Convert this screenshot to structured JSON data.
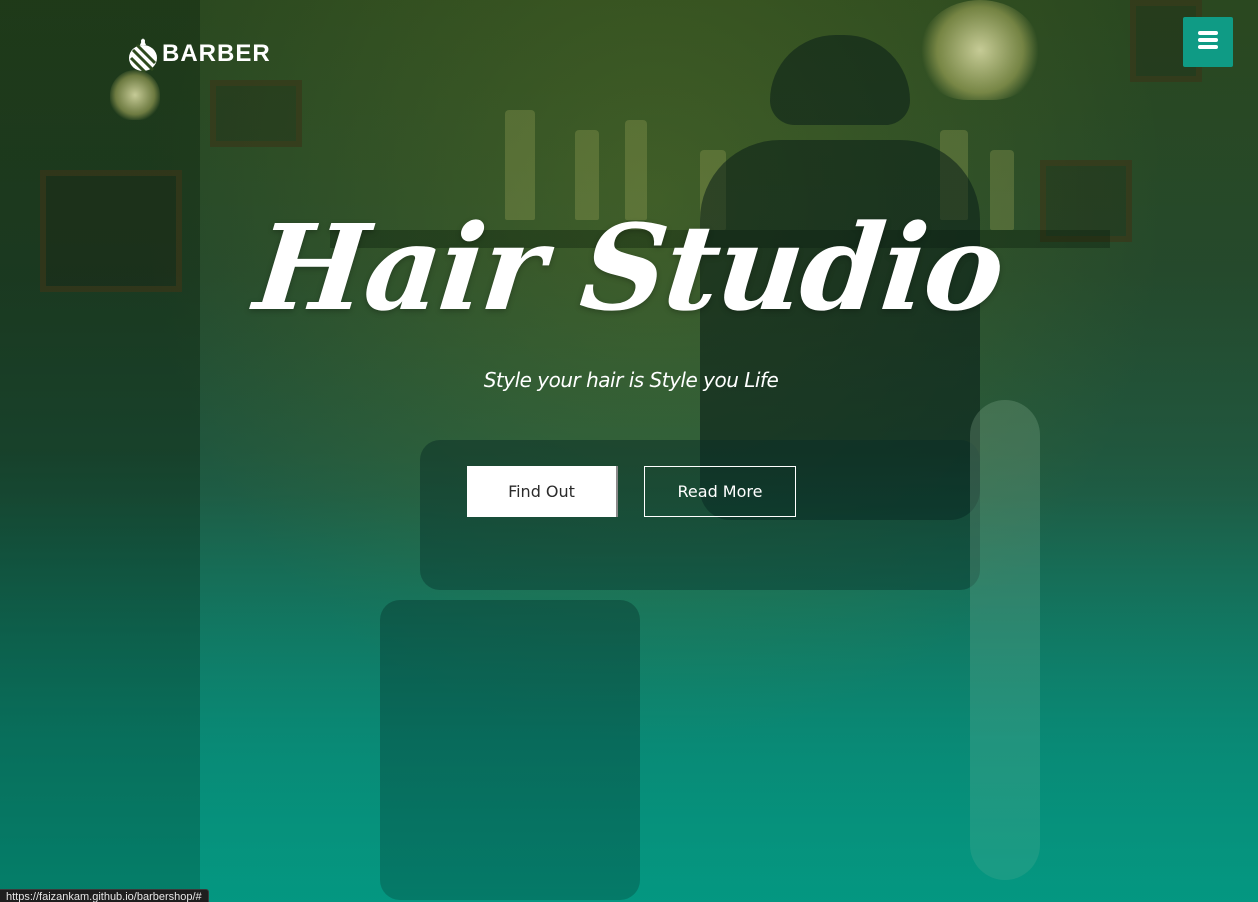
{
  "header": {
    "logo_text": "BARBER",
    "logo_icon": "barber-pole-icon",
    "menu_icon": "hamburger-menu-icon"
  },
  "hero": {
    "title": "Hair Studio",
    "tagline": "Style your hair is Style you Life",
    "buttons": {
      "primary_label": "Find Out",
      "secondary_label": "Read More"
    }
  },
  "status_bar": {
    "url": "https://faizankam.github.io/barbershop/#"
  },
  "colors": {
    "accent": "#0f9b85",
    "text": "#ffffff",
    "bottom_gradient": "#079880"
  }
}
